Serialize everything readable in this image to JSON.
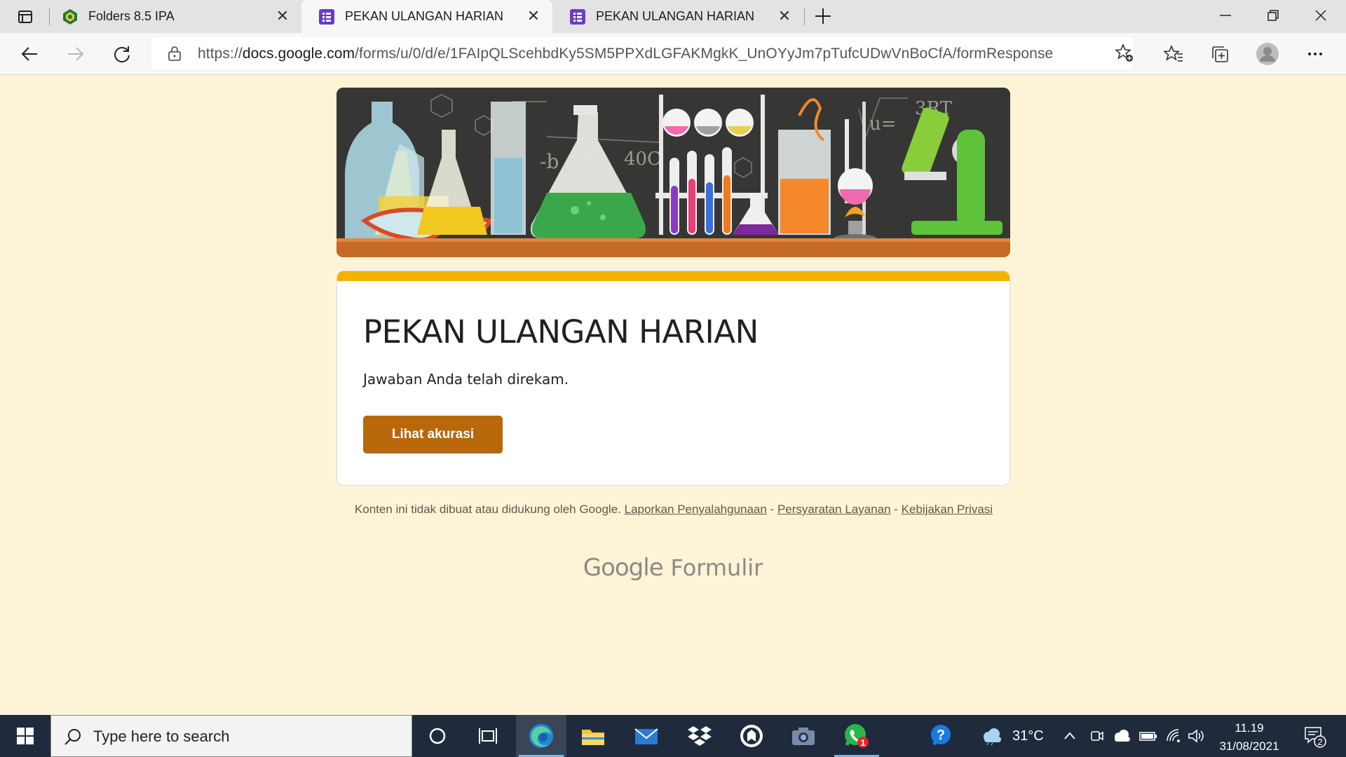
{
  "browser": {
    "tabs": [
      {
        "title": "Folders 8.5 IPA",
        "icon": "folders-favicon",
        "active": false
      },
      {
        "title": "PEKAN ULANGAN HARIAN",
        "icon": "google-forms-favicon",
        "active": true
      },
      {
        "title": "PEKAN ULANGAN HARIAN",
        "icon": "google-forms-favicon",
        "active": false
      }
    ],
    "url_scheme": "https://",
    "url_host": "docs.google.com",
    "url_path": "/forms/u/0/d/e/1FAIpQLScehbdKy5SM5PPXdLGFAKMgkK_UnOYyJm7pTufcUDwVnBoCfA/formResponse"
  },
  "form": {
    "title": "PEKAN ULANGAN HARIAN",
    "confirmation": "Jawaban Anda telah direkam.",
    "view_score_label": "Lihat akurasi",
    "accent_color": "#f0b400",
    "button_color": "#b8680b",
    "background_color": "#fdf3d6"
  },
  "footer": {
    "disclaimer": "Konten ini tidak dibuat atau didukung oleh Google.",
    "link_abuse": "Laporkan Penyalahgunaan",
    "sep1": " - ",
    "link_terms": "Persyaratan Layanan",
    "sep2": " - ",
    "link_privacy": "Kebijakan Privasi",
    "logo_google": "Google",
    "logo_forms": "Formulir"
  },
  "taskbar": {
    "search_placeholder": "Type here to search",
    "weather": "31°C",
    "time": "11.19",
    "date": "31/08/2021",
    "whatsapp_badge": "1",
    "notifications_count": "2"
  }
}
